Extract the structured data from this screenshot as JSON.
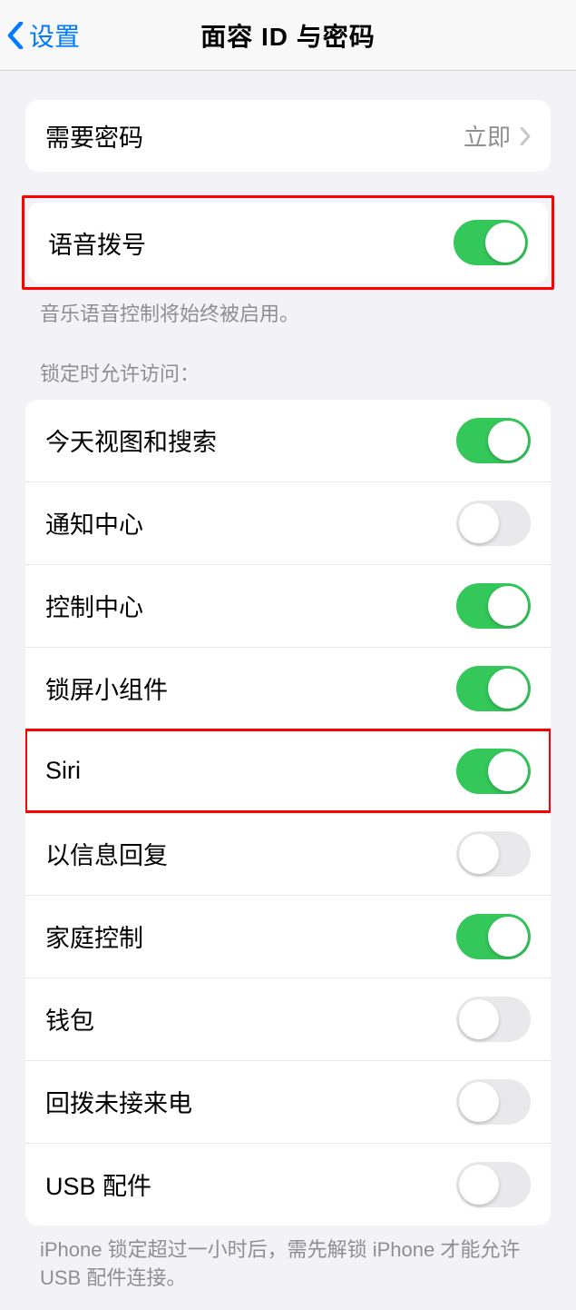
{
  "navbar": {
    "back_label": "设置",
    "title": "面容 ID 与密码"
  },
  "require_passcode": {
    "label": "需要密码",
    "value": "立即"
  },
  "voice_dial": {
    "label": "语音拨号",
    "footer": "音乐语音控制将始终被启用。",
    "on": true
  },
  "allow_access": {
    "header": "锁定时允许访问：",
    "items": [
      {
        "label": "今天视图和搜索",
        "on": true,
        "highlight": false
      },
      {
        "label": "通知中心",
        "on": false,
        "highlight": false
      },
      {
        "label": "控制中心",
        "on": true,
        "highlight": false
      },
      {
        "label": "锁屏小组件",
        "on": true,
        "highlight": false
      },
      {
        "label": "Siri",
        "on": true,
        "highlight": true
      },
      {
        "label": "以信息回复",
        "on": false,
        "highlight": false
      },
      {
        "label": "家庭控制",
        "on": true,
        "highlight": false
      },
      {
        "label": "钱包",
        "on": false,
        "highlight": false
      },
      {
        "label": "回拨未接来电",
        "on": false,
        "highlight": false
      },
      {
        "label": "USB 配件",
        "on": false,
        "highlight": false
      }
    ],
    "footer": "iPhone 锁定超过一小时后，需先解锁 iPhone 才能允许 USB 配件连接。"
  }
}
